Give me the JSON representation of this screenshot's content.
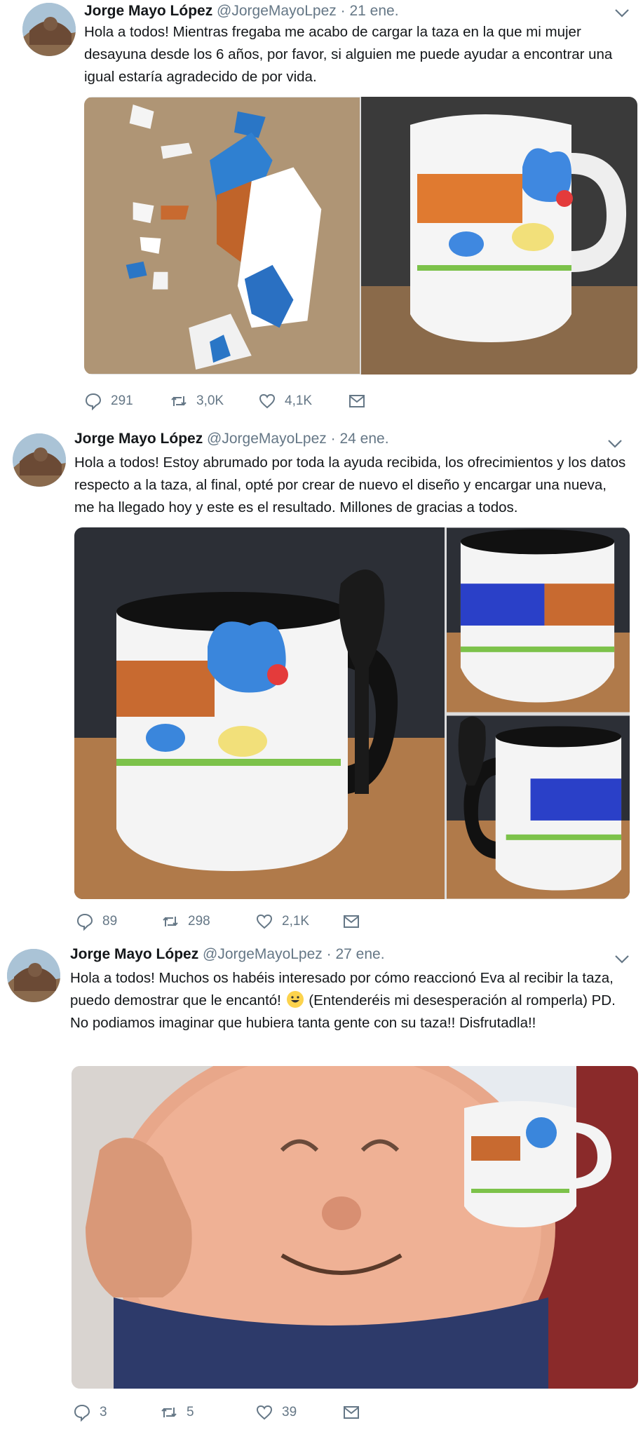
{
  "tweets": [
    {
      "name": "Jorge Mayo López",
      "handle": "@JorgeMayoLpez",
      "sep": "·",
      "date": "21 ene.",
      "text": "Hola a todos! Mientras fregaba me acabo de cargar la taza en la que mi mujer desayuna desde los 6 años, por favor, si alguien me puede ayudar a encontrar una igual estaría agradecido de por vida.",
      "replies": "291",
      "retweets": "3,0K",
      "likes": "4,1K"
    },
    {
      "name": "Jorge Mayo López",
      "handle": "@JorgeMayoLpez",
      "sep": "·",
      "date": "24 ene.",
      "text": "Hola a todos! Estoy abrumado por toda la ayuda recibida, los ofrecimientos y los datos respecto a la taza, al final, opté por crear de nuevo el diseño y encargar una nueva, me ha llegado hoy y este es el resultado. Millones de gracias a todos.",
      "replies": "89",
      "retweets": "298",
      "likes": "2,1K"
    },
    {
      "name": "Jorge Mayo López",
      "handle": "@JorgeMayoLpez",
      "sep": "·",
      "date": "27 ene.",
      "text_before_emoji": "Hola a todos! Muchos os habéis interesado por cómo reaccionó Eva al recibir la taza, puedo demostrar que le encantó!",
      "text_after_emoji": "(Entenderéis mi desesperación al romperla) PD. No podiamos imaginar que hubiera tanta gente con su taza!! Disfrutadla!!",
      "emoji": "grinning-face-emoji",
      "replies": "3",
      "retweets": "5",
      "likes": "39"
    }
  ],
  "icons": {
    "reply": "reply-icon",
    "retweet": "retweet-icon",
    "like": "heart-icon",
    "message": "envelope-icon",
    "menu": "chevron-down-icon"
  },
  "colors": {
    "name_text": "#14171a",
    "meta_text": "#657786",
    "action_icon": "#657786"
  }
}
